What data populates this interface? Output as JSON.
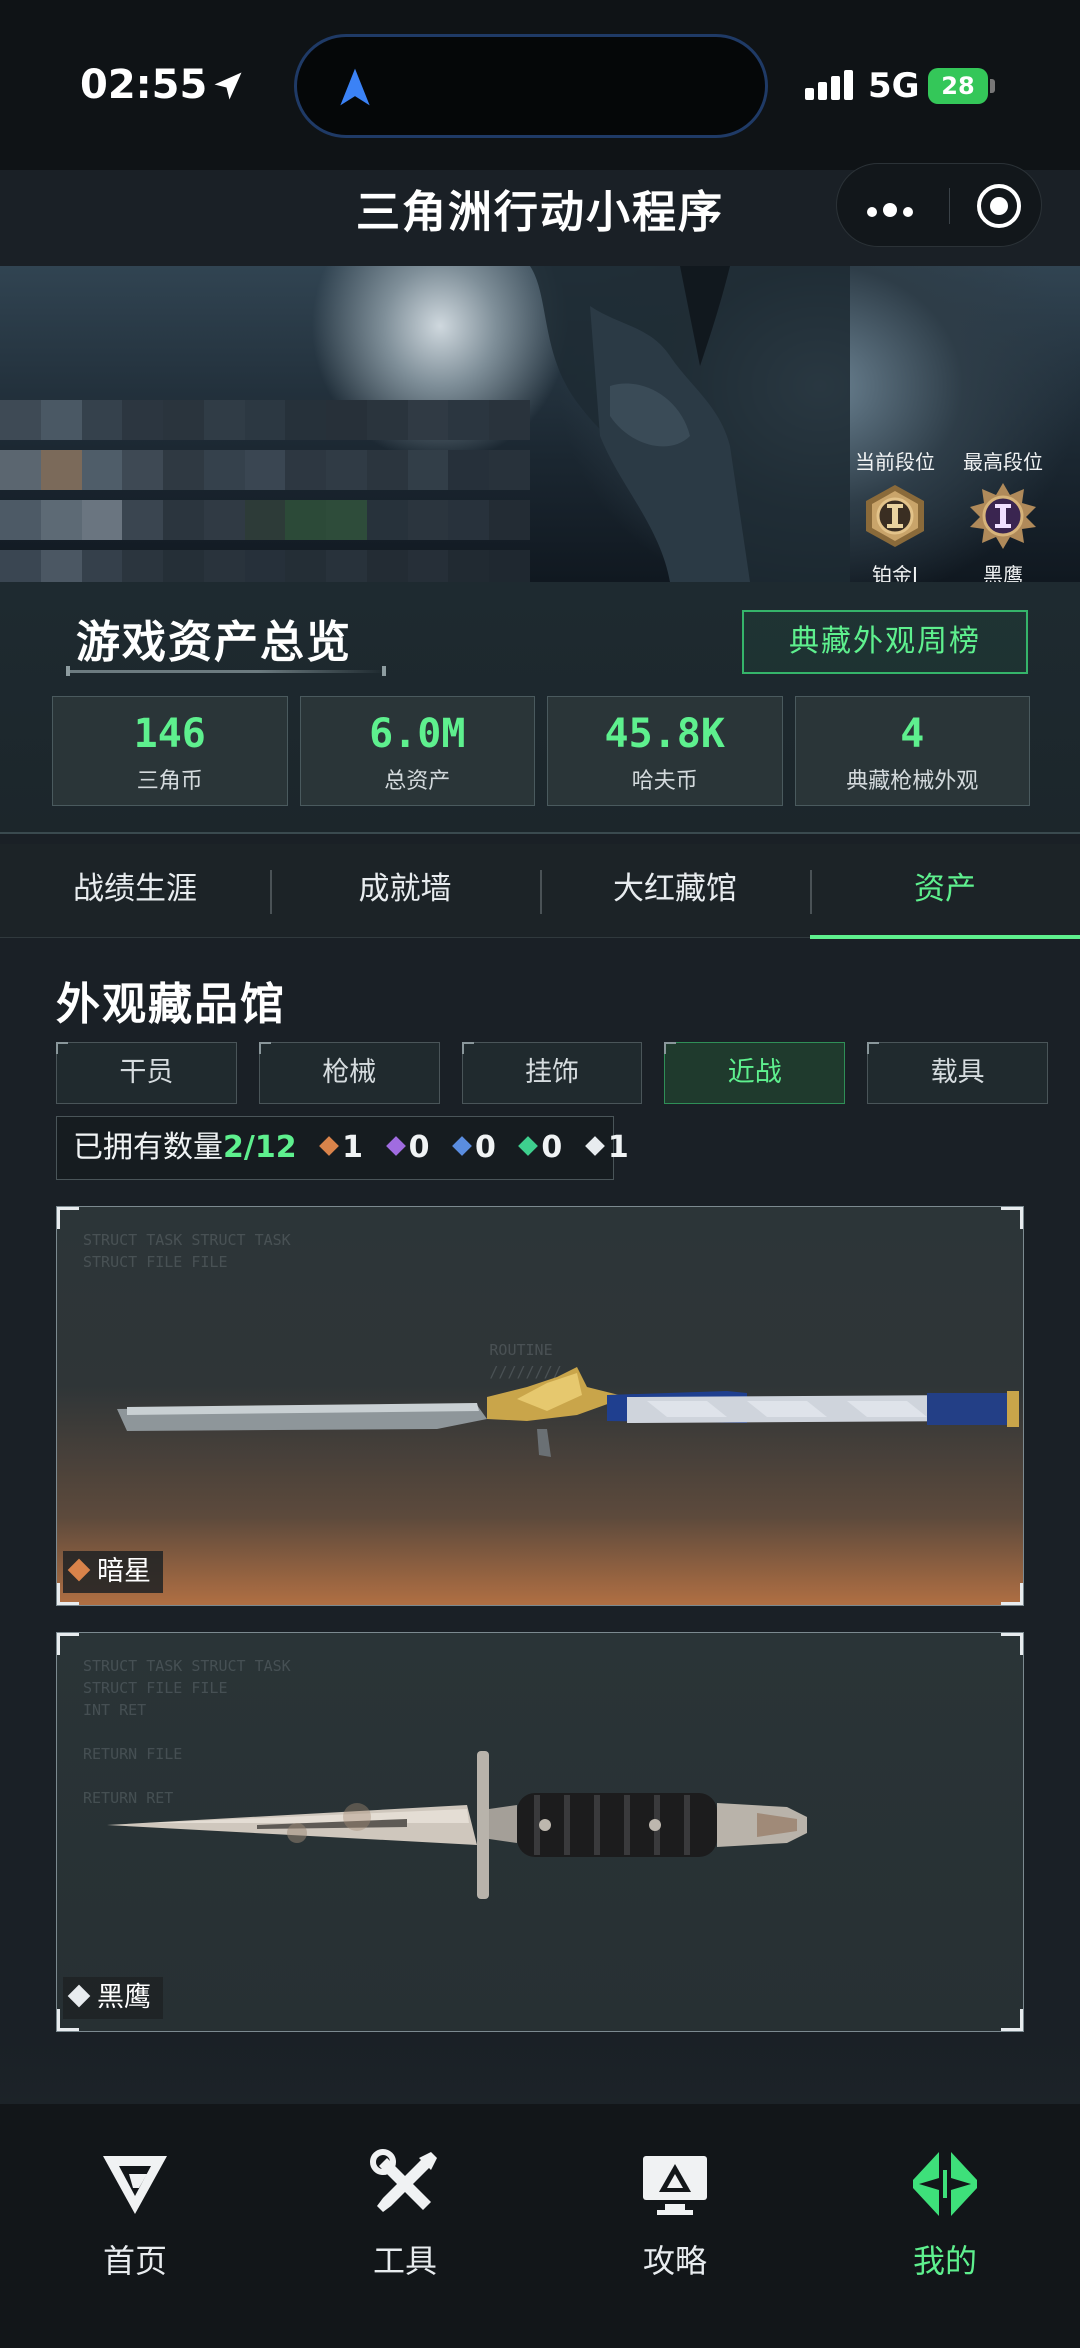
{
  "status_bar": {
    "time": "02:55",
    "network": "5G",
    "battery": "28"
  },
  "header": {
    "title": "三角洲行动小程序"
  },
  "banner": {
    "current_rank_label": "当前段位",
    "current_rank_name": "铂金Ⅰ",
    "best_rank_label": "最高段位",
    "best_rank_name": "黑鹰"
  },
  "overview": {
    "title": "游戏资产总览",
    "weekly_button": "典藏外观周榜",
    "stats": [
      {
        "value": "146",
        "label": "三角币"
      },
      {
        "value": "6.0M",
        "label": "总资产"
      },
      {
        "value": "45.8K",
        "label": "哈夫币"
      },
      {
        "value": "4",
        "label": "典藏枪械外观"
      }
    ]
  },
  "tabs": [
    "战绩生涯",
    "成就墙",
    "大红藏馆",
    "资产"
  ],
  "active_tab": "资产",
  "collection": {
    "title": "外观藏品馆",
    "filters": [
      "干员",
      "枪械",
      "挂饰",
      "近战",
      "载具"
    ],
    "active_filter": "近战",
    "owned_label": "已拥有数量",
    "owned_count": "2/12",
    "rarity_counts": [
      {
        "count": "1",
        "color": "#d9834a"
      },
      {
        "count": "0",
        "color": "#a06ce0"
      },
      {
        "count": "0",
        "color": "#5a8de0"
      },
      {
        "count": "0",
        "color": "#3ecf8e"
      },
      {
        "count": "1",
        "color": "#e8ecef"
      }
    ],
    "items": [
      {
        "name": "暗星",
        "rarity_color": "#d9834a"
      },
      {
        "name": "黑鹰",
        "rarity_color": "#e8ecef"
      }
    ]
  },
  "bottom_nav": [
    {
      "label": "首页",
      "icon": "delta-logo-icon"
    },
    {
      "label": "工具",
      "icon": "tools-icon"
    },
    {
      "label": "攻略",
      "icon": "guide-monitor-icon"
    },
    {
      "label": "我的",
      "icon": "profile-logo-icon"
    }
  ],
  "active_nav": "我的",
  "colors": {
    "accent": "#5ef08e",
    "background": "#1a2026"
  }
}
